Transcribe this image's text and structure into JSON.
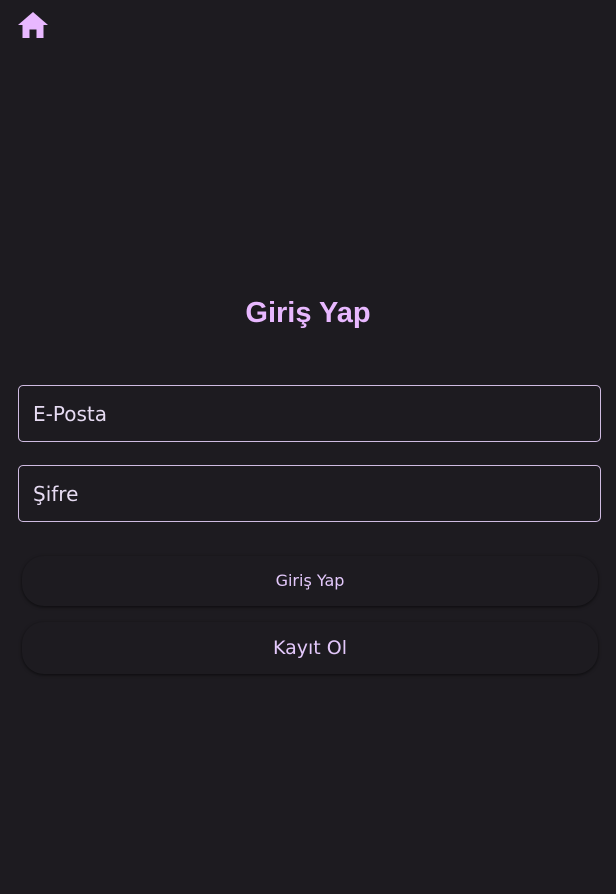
{
  "theme": {
    "background": "#1d1b20",
    "accent": "#e8b8ff",
    "border": "#cfbbe1",
    "text": "#e6dbf2"
  },
  "header": {
    "home_icon": "home-icon"
  },
  "login": {
    "title": "Giriş Yap",
    "email_placeholder": "E-Posta",
    "password_placeholder": "Şifre",
    "login_button": "Giriş Yap",
    "register_button": "Kayıt Ol"
  }
}
